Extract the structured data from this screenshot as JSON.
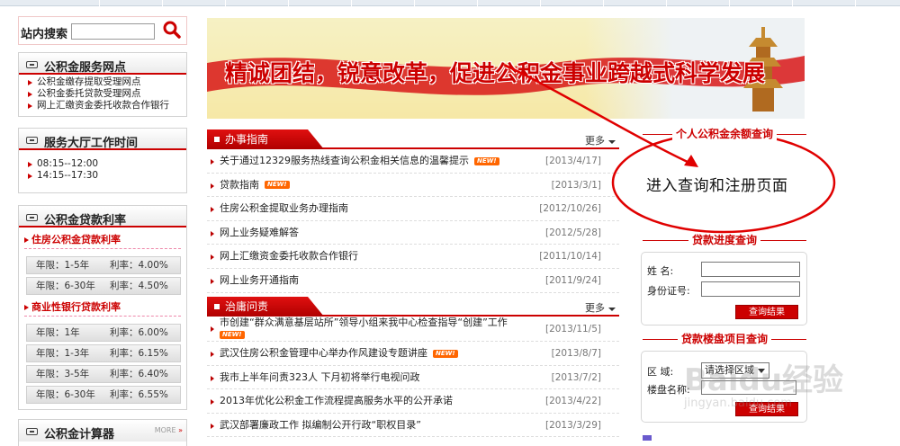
{
  "search": {
    "label": "站内搜索",
    "value": ""
  },
  "outlets": {
    "title": "公积金服务网点",
    "items": [
      "公积金缴存提取受理网点",
      "公积金委托贷款受理网点",
      "网上汇缴资金委托收款合作银行"
    ]
  },
  "hours": {
    "title": "服务大厅工作时间",
    "items": [
      "08:15--12:00",
      "14:15--17:30"
    ]
  },
  "rates": {
    "title": "公积金贷款利率",
    "housing": {
      "title": "住房公积金贷款利率",
      "rows": [
        {
          "term": "年限：1-5年",
          "rate": "利率：4.00%"
        },
        {
          "term": "年限：6-30年",
          "rate": "利率：4.50%"
        }
      ]
    },
    "commercial": {
      "title": "商业性银行贷款利率",
      "rows": [
        {
          "term": "年限：1年",
          "rate": "利率：6.00%"
        },
        {
          "term": "年限：1-3年",
          "rate": "利率：6.15%"
        },
        {
          "term": "年限：3-5年",
          "rate": "利率：6.40%"
        },
        {
          "term": "年限：6-30年",
          "rate": "利率：6.55%"
        }
      ]
    }
  },
  "calculator": {
    "title": "公积金计算器",
    "more": "MORE"
  },
  "banner": {
    "slogan": "精诚团结，锐意改革，促进公积金事业跨越式科学发展"
  },
  "guide": {
    "title": "办事指南",
    "more": "更多",
    "items": [
      {
        "text": "关于通过12329服务热线查询公积金相关信息的温馨提示",
        "date": "[2013/4/17]",
        "new": "NEW!"
      },
      {
        "text": "贷款指南",
        "date": "[2013/3/1]",
        "new": "NEW!"
      },
      {
        "text": "住房公积金提取业务办理指南",
        "date": "[2012/10/26]",
        "new": ""
      },
      {
        "text": "网上业务疑难解答",
        "date": "[2012/5/28]",
        "new": ""
      },
      {
        "text": "网上汇缴资金委托收款合作银行",
        "date": "[2011/10/14]",
        "new": ""
      },
      {
        "text": "网上业务开通指南",
        "date": "[2011/9/24]",
        "new": ""
      }
    ]
  },
  "governance": {
    "title": "治庸问责",
    "more": "更多",
    "items": [
      {
        "text": "市创建“群众满意基层站所”领导小组来我中心检查指导“创建”工作",
        "date": "[2013/11/5]",
        "new": "NEW!"
      },
      {
        "text": "武汉住房公积金管理中心举办作风建设专题讲座",
        "date": "[2013/8/7]",
        "new": "NEW!"
      },
      {
        "text": "我市上半年问责323人 下月初将举行电视问政",
        "date": "[2013/7/2]",
        "new": ""
      },
      {
        "text": "2013年优化公积金工作流程提高服务水平的公开承诺",
        "date": "[2013/4/22]",
        "new": ""
      },
      {
        "text": "武汉部署廉政工作 拟编制公开行政“职权目录”",
        "date": "[2013/3/29]",
        "new": ""
      }
    ]
  },
  "balance": {
    "title": "个人公积金余额查询",
    "link": "进入查询和注册页面"
  },
  "progress": {
    "title": "贷款进度查询",
    "name_label": "姓    名:",
    "id_label": "身份证号:",
    "button": "查询结果"
  },
  "property": {
    "title": "贷款楼盘项目查询",
    "area_label": "区    域:",
    "area_value": "请选择区域",
    "name_label": "楼盘名称:",
    "button": "查询结果"
  },
  "watermark": {
    "brand": "Baidu经验",
    "url": "jingyan.baidu.com"
  },
  "colors": {
    "accent": "#cc0000",
    "annotation": "#e00000"
  }
}
